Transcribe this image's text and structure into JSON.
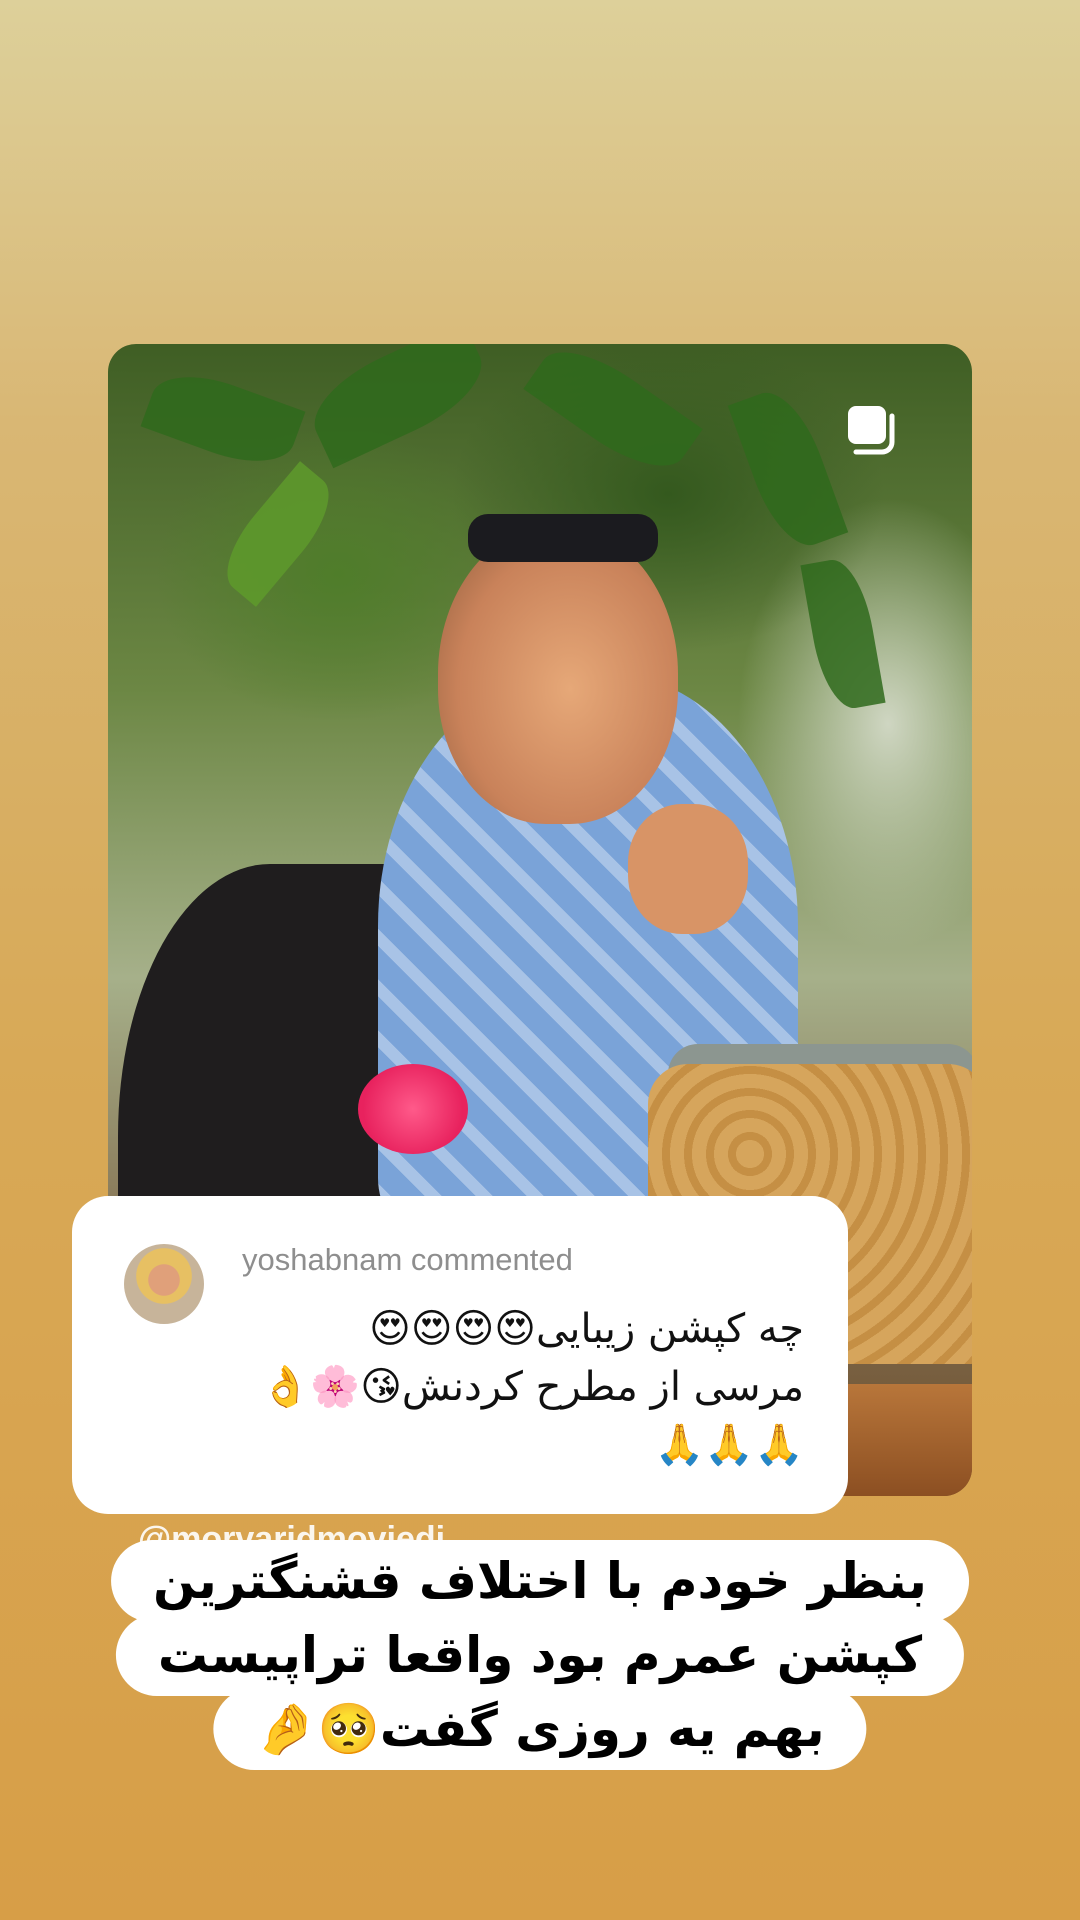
{
  "comment": {
    "username": "yoshabnam",
    "action": "commented",
    "lines": [
      "چه کپشن زیبایی😍😍😍😍",
      "مرسی از مطرح کردنش😘🌸👌",
      "🙏🙏🙏"
    ]
  },
  "mention": "@morvaridmovjedi",
  "caption": {
    "lines": [
      "بنظر خودم با اختلاف قشنگترین",
      "کپشن عمرم بود واقعا تراپیست",
      "بهم یه روزی گفت🥺🤌"
    ]
  },
  "icons": {
    "carousel": "multiple-posts-icon"
  }
}
